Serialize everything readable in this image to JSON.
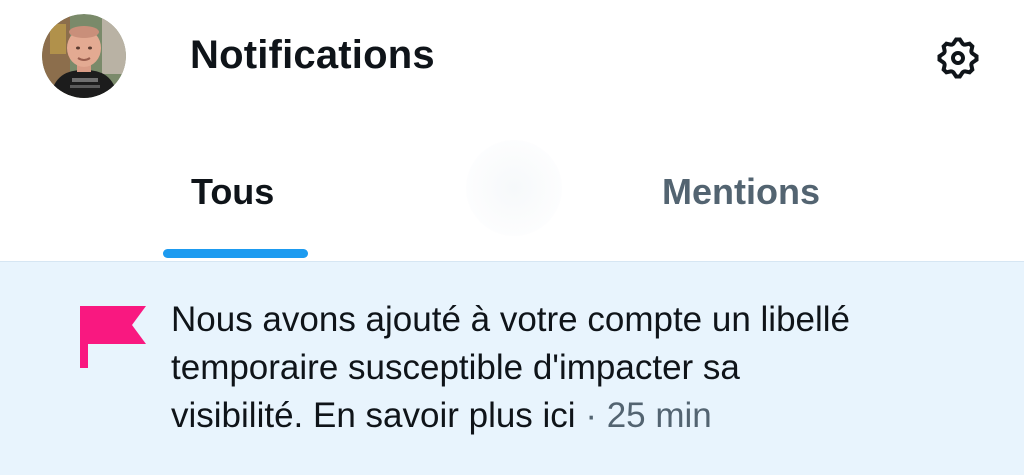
{
  "header": {
    "title": "Notifications",
    "avatar_icon": "user-avatar",
    "settings_icon": "gear-icon"
  },
  "tabs": [
    {
      "label": "Tous",
      "active": true
    },
    {
      "label": "Mentions",
      "active": false
    }
  ],
  "notification": {
    "icon": "flag-icon",
    "line1": "Nous avons ajouté à votre compte un libellé",
    "line2": "temporaire susceptible d'impacter sa",
    "line3_text": "visibilité. En savoir plus ici",
    "separator": " · ",
    "time": "25 min"
  },
  "colors": {
    "accent": "#1d9bf0",
    "flag": "#f91880",
    "notification_background": "#e8f4fd",
    "text_primary": "#0f1419",
    "text_secondary": "#536471"
  }
}
